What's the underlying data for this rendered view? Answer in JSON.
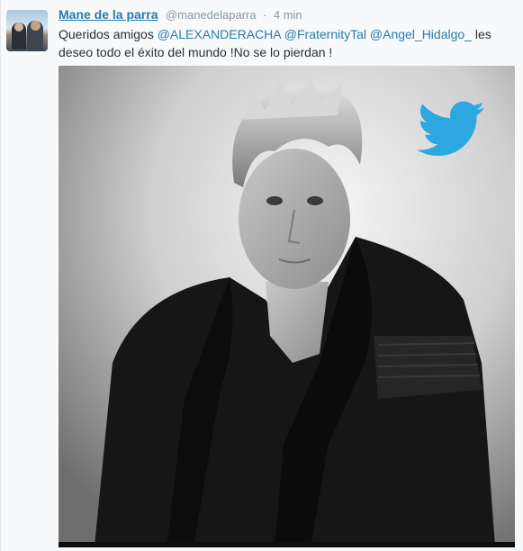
{
  "tweet": {
    "display_name": "Mane de la parra",
    "handle": "@manedelaparra",
    "separator": "·",
    "time": "4 min",
    "text_parts": [
      "Queridos amigos ",
      "@ALEXANDERACHA",
      " ",
      "@FraternityTal",
      " ",
      "@Angel_Hidalgo_",
      " les deseo todo el éxito del mundo !No se lo pierdan !"
    ]
  },
  "media": {
    "logo_icon": "twitter-bird-icon",
    "logo_color": "#2ca7e0"
  },
  "colors": {
    "link": "#2a7ab0",
    "text": "#292f33",
    "muted": "#8899a6"
  }
}
